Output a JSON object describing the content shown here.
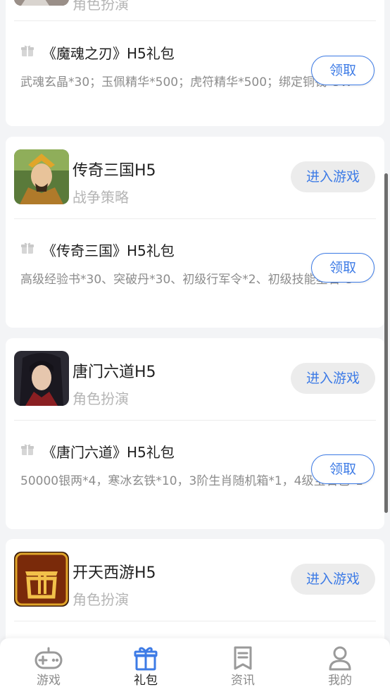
{
  "cards": [
    {
      "game": {
        "name": "",
        "genre": "角色扮演",
        "enter_label": ""
      },
      "gift": {
        "title": "《魔魂之刃》H5礼包",
        "desc": "武魂玄晶*30；玉佩精华*500；虎符精华*500；绑定铜钱*5W",
        "claim_label": "领取"
      }
    },
    {
      "game": {
        "name": "传奇三国H5",
        "genre": "战争策略",
        "enter_label": "进入游戏"
      },
      "gift": {
        "title": "《传奇三国》H5礼包",
        "desc": "高级经验书*30、突破丹*30、初级行军令*2、初级技能星石*5",
        "claim_label": "领取"
      }
    },
    {
      "game": {
        "name": "唐门六道H5",
        "genre": "角色扮演",
        "enter_label": "进入游戏"
      },
      "gift": {
        "title": "《唐门六道》H5礼包",
        "desc": "50000银两*4，寒冰玄铁*10，3阶生肖随机箱*1，4级宝石包*1",
        "claim_label": "领取"
      }
    },
    {
      "game": {
        "name": "开天西游H5",
        "genre": "角色扮演",
        "enter_label": "进入游戏"
      },
      "gift": null
    }
  ],
  "tabbar": {
    "tabs": [
      {
        "label": "游戏",
        "icon": "gamepad-icon",
        "active": false
      },
      {
        "label": "礼包",
        "icon": "gift-icon",
        "active": true
      },
      {
        "label": "资讯",
        "icon": "news-icon",
        "active": false
      },
      {
        "label": "我的",
        "icon": "user-icon",
        "active": false
      }
    ]
  },
  "colors": {
    "accent": "#3d7be6",
    "page_bg": "#f3f4f6",
    "muted_text": "#8c8c8c"
  }
}
